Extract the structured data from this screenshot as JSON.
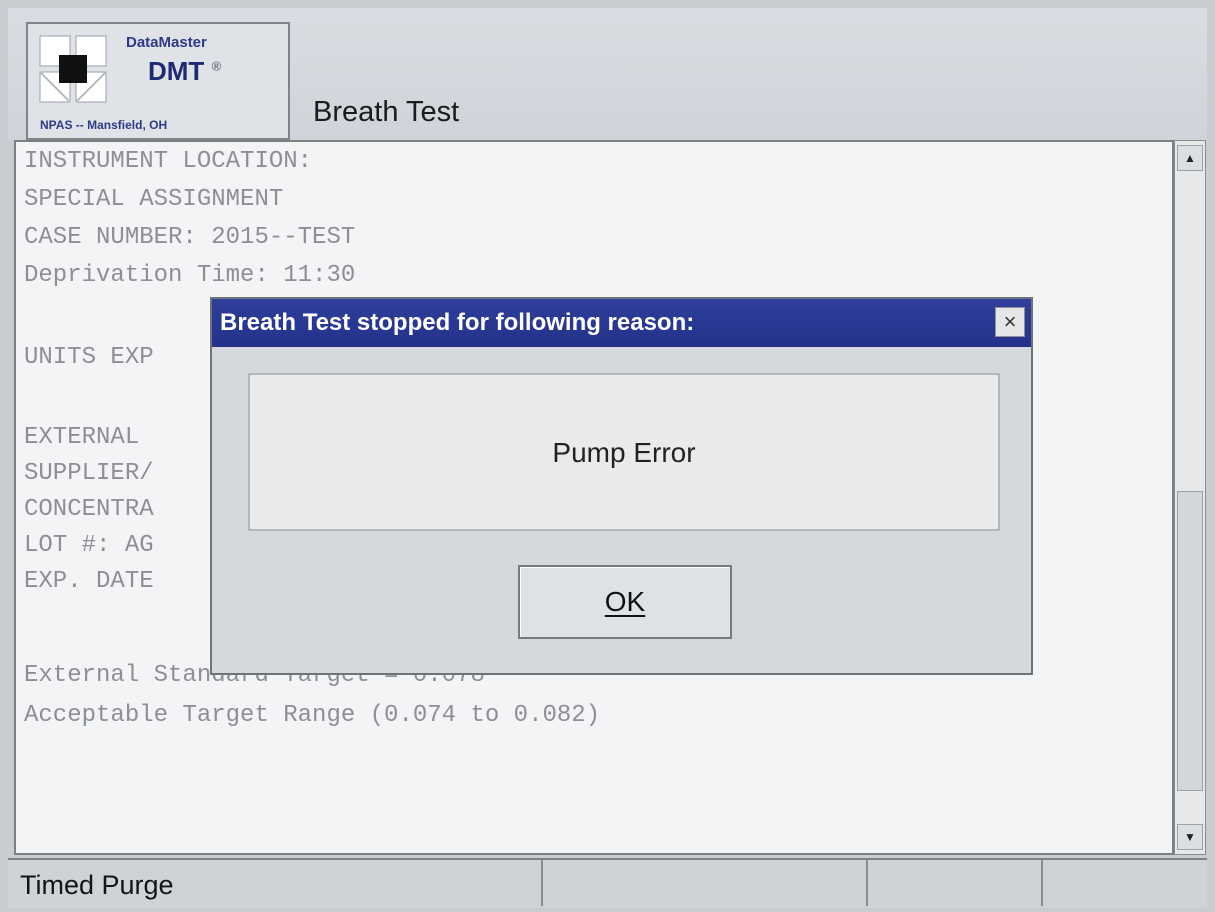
{
  "header": {
    "logo_name": "DataMaster",
    "logo_dmt": "DMT",
    "logo_reg": "®",
    "logo_location": "NPAS -- Mansfield, OH",
    "screen_title": "Breath Test"
  },
  "content_lines": [
    "INSTRUMENT LOCATION:",
    "SPECIAL ASSIGNMENT",
    "CASE NUMBER: 2015--TEST",
    "Deprivation Time: 11:30",
    "",
    "UNITS EXP",
    "",
    "EXTERNAL",
    "SUPPLIER/",
    "CONCENTRA",
    "LOT #: AG",
    "EXP. DATE",
    "",
    "External Standard Target = 0.078",
    "Acceptable Target Range (0.074 to 0.082)"
  ],
  "dialog": {
    "title": "Breath Test stopped for following reason:",
    "message": "Pump Error",
    "ok_label": "OK",
    "close_glyph": "×"
  },
  "scrollbar": {
    "up_glyph": "▲",
    "down_glyph": "▼"
  },
  "statusbar": {
    "cells": [
      "Timed Purge",
      "",
      "",
      ""
    ]
  },
  "colors": {
    "dialog_title_bg": "#2f3f9a",
    "content_text": "#8d8f93",
    "logo_text": "#2d3a86"
  }
}
